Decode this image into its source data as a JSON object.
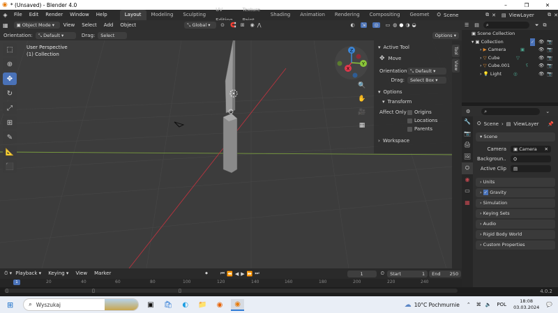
{
  "window": {
    "title": "* (Unsaved) - Blender 4.0",
    "controls": [
      "–",
      "❐",
      "✕"
    ]
  },
  "menu": [
    "File",
    "Edit",
    "Render",
    "Window",
    "Help"
  ],
  "workspaces": [
    "Layout",
    "Modeling",
    "Sculpting",
    "UV Editing",
    "Texture Paint",
    "Shading",
    "Animation",
    "Rendering",
    "Compositing",
    "Geomet"
  ],
  "scene_name": "Scene",
  "view_layer": "ViewLayer",
  "viewport_header": {
    "mode": "Object Mode",
    "menus": [
      "View",
      "Select",
      "Add",
      "Object"
    ],
    "transform_orientation": "Global",
    "options": "Options"
  },
  "viewport_header2": {
    "orientation_label": "Orientation:",
    "orientation_value": "Default",
    "drag_label": "Drag:",
    "drag_value": "Select Box"
  },
  "viewport": {
    "perspective": "User Perspective",
    "collection": "(1) Collection"
  },
  "gizmo": {
    "x": "X",
    "y": "Y",
    "z": "Z"
  },
  "npanel": {
    "active_tool": "Active Tool",
    "move": "Move",
    "orientation_label": "Orientation",
    "orientation_value": "Default",
    "drag_label": "Drag:",
    "drag_value": "Select Box",
    "options": "Options",
    "transform": "Transform",
    "affect_only": "Affect Only",
    "origins": "Origins",
    "locations": "Locations",
    "parents": "Parents",
    "workspace": "Workspace",
    "tabs": [
      "Tool",
      "View"
    ]
  },
  "outliner": {
    "title": "Scene Collection",
    "items": [
      {
        "name": "Collection"
      },
      {
        "name": "Camera"
      },
      {
        "name": "Cube"
      },
      {
        "name": "Cube.001"
      },
      {
        "name": "Light"
      }
    ]
  },
  "properties": {
    "breadcrumb_scene": "Scene",
    "breadcrumb_layer": "ViewLayer",
    "section_scene": "Scene",
    "camera_label": "Camera",
    "camera_value": "Camera",
    "background_label": "Backgroun...",
    "active_clip_label": "Active Clip",
    "sections": [
      "Units",
      "Gravity",
      "Simulation",
      "Keying Sets",
      "Audio",
      "Rigid Body World",
      "Custom Properties"
    ]
  },
  "timeline": {
    "menus": [
      "Playback",
      "Keying",
      "View",
      "Marker"
    ],
    "current_frame": "1",
    "start_label": "Start",
    "start_value": "1",
    "end_label": "End",
    "end_value": "250",
    "ticks": [
      "1",
      "20",
      "40",
      "60",
      "80",
      "100",
      "120",
      "140",
      "160",
      "180",
      "200",
      "220",
      "240"
    ]
  },
  "version": "4.0.2",
  "taskbar": {
    "search_placeholder": "Wyszukaj",
    "weather": "10°C Pochmurnie",
    "language": "POL",
    "time": "18:08",
    "date": "03.03.2024"
  },
  "colors": {
    "accent": "#4a72b8",
    "x_axis": "#e0394c",
    "y_axis": "#8ac53a",
    "z_axis": "#3d86d6"
  }
}
